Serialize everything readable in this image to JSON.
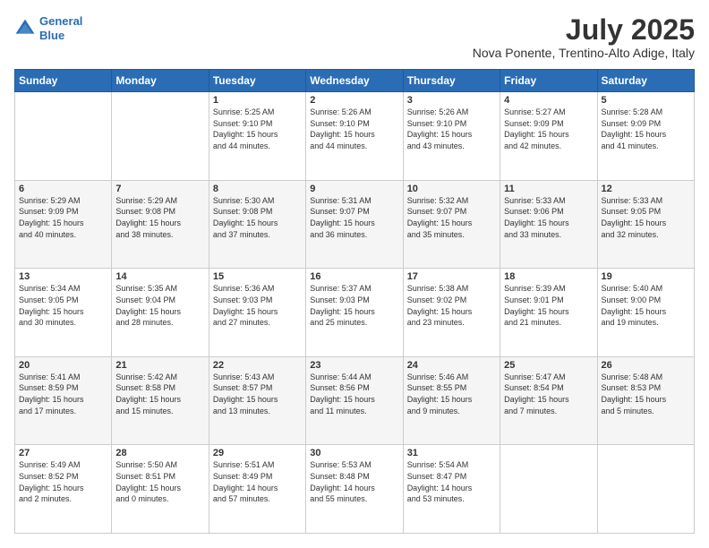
{
  "header": {
    "logo_line1": "General",
    "logo_line2": "Blue",
    "title": "July 2025",
    "subtitle": "Nova Ponente, Trentino-Alto Adige, Italy"
  },
  "calendar": {
    "days_of_week": [
      "Sunday",
      "Monday",
      "Tuesday",
      "Wednesday",
      "Thursday",
      "Friday",
      "Saturday"
    ],
    "weeks": [
      [
        {
          "day": "",
          "info": ""
        },
        {
          "day": "",
          "info": ""
        },
        {
          "day": "1",
          "info": "Sunrise: 5:25 AM\nSunset: 9:10 PM\nDaylight: 15 hours\nand 44 minutes."
        },
        {
          "day": "2",
          "info": "Sunrise: 5:26 AM\nSunset: 9:10 PM\nDaylight: 15 hours\nand 44 minutes."
        },
        {
          "day": "3",
          "info": "Sunrise: 5:26 AM\nSunset: 9:10 PM\nDaylight: 15 hours\nand 43 minutes."
        },
        {
          "day": "4",
          "info": "Sunrise: 5:27 AM\nSunset: 9:09 PM\nDaylight: 15 hours\nand 42 minutes."
        },
        {
          "day": "5",
          "info": "Sunrise: 5:28 AM\nSunset: 9:09 PM\nDaylight: 15 hours\nand 41 minutes."
        }
      ],
      [
        {
          "day": "6",
          "info": "Sunrise: 5:29 AM\nSunset: 9:09 PM\nDaylight: 15 hours\nand 40 minutes."
        },
        {
          "day": "7",
          "info": "Sunrise: 5:29 AM\nSunset: 9:08 PM\nDaylight: 15 hours\nand 38 minutes."
        },
        {
          "day": "8",
          "info": "Sunrise: 5:30 AM\nSunset: 9:08 PM\nDaylight: 15 hours\nand 37 minutes."
        },
        {
          "day": "9",
          "info": "Sunrise: 5:31 AM\nSunset: 9:07 PM\nDaylight: 15 hours\nand 36 minutes."
        },
        {
          "day": "10",
          "info": "Sunrise: 5:32 AM\nSunset: 9:07 PM\nDaylight: 15 hours\nand 35 minutes."
        },
        {
          "day": "11",
          "info": "Sunrise: 5:33 AM\nSunset: 9:06 PM\nDaylight: 15 hours\nand 33 minutes."
        },
        {
          "day": "12",
          "info": "Sunrise: 5:33 AM\nSunset: 9:05 PM\nDaylight: 15 hours\nand 32 minutes."
        }
      ],
      [
        {
          "day": "13",
          "info": "Sunrise: 5:34 AM\nSunset: 9:05 PM\nDaylight: 15 hours\nand 30 minutes."
        },
        {
          "day": "14",
          "info": "Sunrise: 5:35 AM\nSunset: 9:04 PM\nDaylight: 15 hours\nand 28 minutes."
        },
        {
          "day": "15",
          "info": "Sunrise: 5:36 AM\nSunset: 9:03 PM\nDaylight: 15 hours\nand 27 minutes."
        },
        {
          "day": "16",
          "info": "Sunrise: 5:37 AM\nSunset: 9:03 PM\nDaylight: 15 hours\nand 25 minutes."
        },
        {
          "day": "17",
          "info": "Sunrise: 5:38 AM\nSunset: 9:02 PM\nDaylight: 15 hours\nand 23 minutes."
        },
        {
          "day": "18",
          "info": "Sunrise: 5:39 AM\nSunset: 9:01 PM\nDaylight: 15 hours\nand 21 minutes."
        },
        {
          "day": "19",
          "info": "Sunrise: 5:40 AM\nSunset: 9:00 PM\nDaylight: 15 hours\nand 19 minutes."
        }
      ],
      [
        {
          "day": "20",
          "info": "Sunrise: 5:41 AM\nSunset: 8:59 PM\nDaylight: 15 hours\nand 17 minutes."
        },
        {
          "day": "21",
          "info": "Sunrise: 5:42 AM\nSunset: 8:58 PM\nDaylight: 15 hours\nand 15 minutes."
        },
        {
          "day": "22",
          "info": "Sunrise: 5:43 AM\nSunset: 8:57 PM\nDaylight: 15 hours\nand 13 minutes."
        },
        {
          "day": "23",
          "info": "Sunrise: 5:44 AM\nSunset: 8:56 PM\nDaylight: 15 hours\nand 11 minutes."
        },
        {
          "day": "24",
          "info": "Sunrise: 5:46 AM\nSunset: 8:55 PM\nDaylight: 15 hours\nand 9 minutes."
        },
        {
          "day": "25",
          "info": "Sunrise: 5:47 AM\nSunset: 8:54 PM\nDaylight: 15 hours\nand 7 minutes."
        },
        {
          "day": "26",
          "info": "Sunrise: 5:48 AM\nSunset: 8:53 PM\nDaylight: 15 hours\nand 5 minutes."
        }
      ],
      [
        {
          "day": "27",
          "info": "Sunrise: 5:49 AM\nSunset: 8:52 PM\nDaylight: 15 hours\nand 2 minutes."
        },
        {
          "day": "28",
          "info": "Sunrise: 5:50 AM\nSunset: 8:51 PM\nDaylight: 15 hours\nand 0 minutes."
        },
        {
          "day": "29",
          "info": "Sunrise: 5:51 AM\nSunset: 8:49 PM\nDaylight: 14 hours\nand 57 minutes."
        },
        {
          "day": "30",
          "info": "Sunrise: 5:53 AM\nSunset: 8:48 PM\nDaylight: 14 hours\nand 55 minutes."
        },
        {
          "day": "31",
          "info": "Sunrise: 5:54 AM\nSunset: 8:47 PM\nDaylight: 14 hours\nand 53 minutes."
        },
        {
          "day": "",
          "info": ""
        },
        {
          "day": "",
          "info": ""
        }
      ]
    ]
  }
}
